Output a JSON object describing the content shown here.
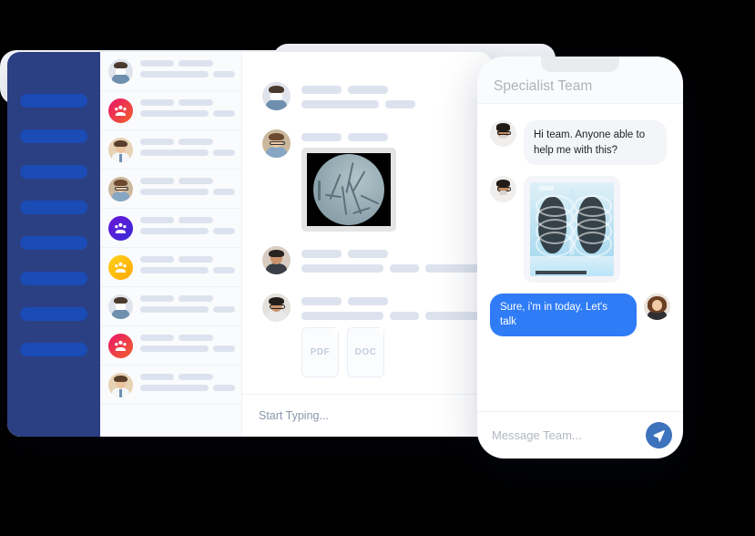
{
  "theme": {
    "page_background": "#000000",
    "nav_rail_color": "#2b4083",
    "nav_pill_color": "#1b4bb5",
    "placeholder_bar_color": "#dde3ee",
    "outgoing_bubble_color": "#2f7cf6",
    "incoming_bubble_color": "#f4f5f8",
    "send_button_color": "#3d72bd"
  },
  "desktop": {
    "nav_rail": {
      "item_count": 8,
      "items": [
        "",
        "",
        "",
        "",
        "",
        "",
        "",
        ""
      ]
    },
    "contact_list": [
      {
        "avatar": "doctor-mask-avatar",
        "avatar_type": "photo"
      },
      {
        "avatar": "group-icon-pink",
        "avatar_type": "group"
      },
      {
        "avatar": "doctor-male-avatar",
        "avatar_type": "photo"
      },
      {
        "avatar": "doctor-female-glasses-avatar",
        "avatar_type": "photo"
      },
      {
        "avatar": "group-icon-purple",
        "avatar_type": "group"
      },
      {
        "avatar": "group-icon-yellow",
        "avatar_type": "group"
      },
      {
        "avatar": "doctor-mask-avatar",
        "avatar_type": "photo"
      },
      {
        "avatar": "group-icon-pink",
        "avatar_type": "group"
      },
      {
        "avatar": "doctor-male-avatar",
        "avatar_type": "photo"
      }
    ],
    "conversation": {
      "messages": [
        {
          "avatar": "doctor-mask-avatar",
          "type": "text-placeholder"
        },
        {
          "avatar": "doctor-female-glasses-avatar",
          "type": "image",
          "image": "angiogram-scan"
        },
        {
          "avatar": "doctor-beard-avatar",
          "type": "text-placeholder"
        },
        {
          "avatar": "doctor-glasses-avatar",
          "type": "attachments",
          "attachments": [
            "PDF",
            "DOC"
          ]
        }
      ]
    },
    "composer": {
      "placeholder": "Start Typing..."
    }
  },
  "phone": {
    "header": {
      "title": "Specialist Team"
    },
    "messages": [
      {
        "direction": "incoming",
        "avatar": "doctor-beard-glasses-avatar",
        "text": "Hi team. Anyone able to help me with this?"
      },
      {
        "direction": "incoming",
        "avatar": "doctor-beard-glasses-avatar",
        "type": "image",
        "image": "chest-xray"
      },
      {
        "direction": "outgoing",
        "avatar": "woman-brown-hair-avatar",
        "text": "Sure, i'm in today. Let's talk"
      }
    ],
    "composer": {
      "placeholder": "Message Team...",
      "send_icon": "paper-plane-icon"
    }
  }
}
